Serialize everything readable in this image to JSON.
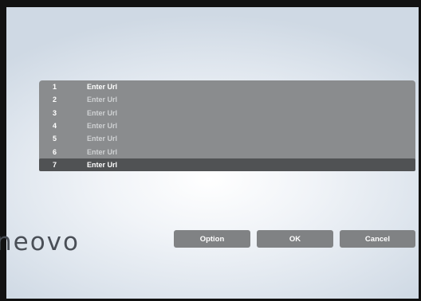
{
  "url_list": {
    "items": [
      {
        "number": "1",
        "label": "Enter Url"
      },
      {
        "number": "2",
        "label": "Enter Url"
      },
      {
        "number": "3",
        "label": "Enter Url"
      },
      {
        "number": "4",
        "label": "Enter Url"
      },
      {
        "number": "5",
        "label": "Enter Url"
      },
      {
        "number": "6",
        "label": "Enter Url"
      },
      {
        "number": "7",
        "label": "Enter Url"
      }
    ],
    "selected_index": 6
  },
  "buttons": {
    "option": "Option",
    "ok": "OK",
    "cancel": "Cancel"
  },
  "brand": {
    "logo_text": "neovo"
  },
  "colors": {
    "panel": "#8a8c8e",
    "selected_row": "#505254",
    "button": "#808284",
    "logo": "#4a4f57"
  }
}
